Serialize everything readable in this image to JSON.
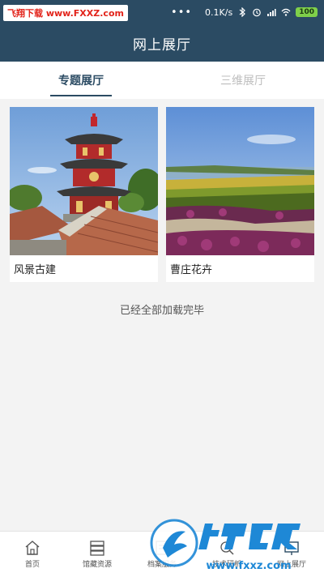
{
  "status_bar": {
    "watermark": "飞翔下载 www.FXXZ.com",
    "dots": "•••",
    "speed": "0.1K/s",
    "battery": "100"
  },
  "header": {
    "title": "网上展厅"
  },
  "tabs": [
    {
      "label": "专题展厅",
      "active": true
    },
    {
      "label": "三维展厅",
      "active": false
    }
  ],
  "cards": [
    {
      "label": "风景古建",
      "image": "pagoda-photo"
    },
    {
      "label": "曹庄花卉",
      "image": "flower-field-photo"
    }
  ],
  "end_message": "已经全部加载完毕",
  "bottom_nav": [
    {
      "label": "首页",
      "icon": "home-icon"
    },
    {
      "label": "馆藏资源",
      "icon": "archive-icon"
    },
    {
      "label": "档案服务",
      "icon": "service-icon"
    },
    {
      "label": "技术研析",
      "icon": "research-icon"
    },
    {
      "label": "网上展厅",
      "icon": "exhibition-icon"
    }
  ],
  "watermark_logo": {
    "name": "飞翔下载",
    "url": "www.fxxz.com"
  },
  "colors": {
    "primary": "#2b4b63",
    "accent_watermark": "#e2231a",
    "logo_blue": "#1e88d6"
  }
}
